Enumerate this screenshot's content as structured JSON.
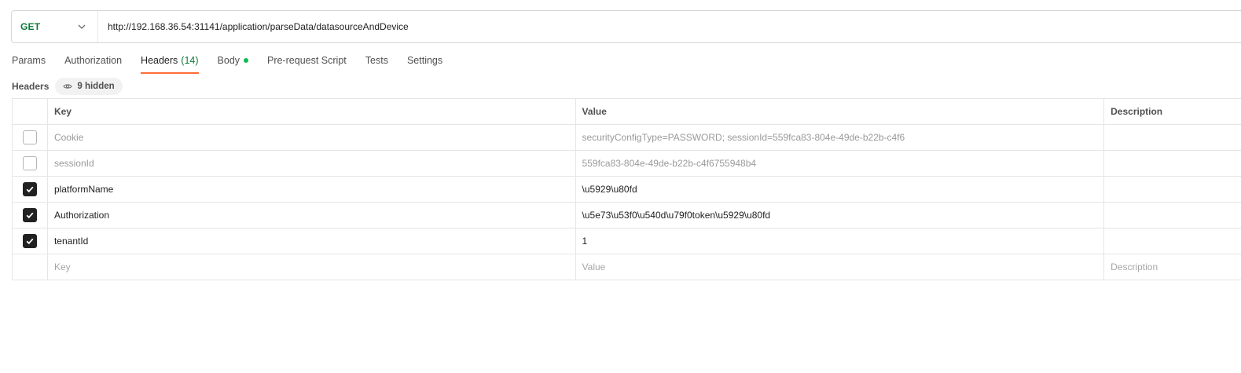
{
  "request": {
    "method": "GET",
    "url": "http://192.168.36.54:31141/application/parseData/datasourceAndDevice"
  },
  "tabs": [
    {
      "label": "Params"
    },
    {
      "label": "Authorization"
    },
    {
      "label": "Headers",
      "count": "(14)",
      "active": true
    },
    {
      "label": "Body",
      "indicator": "green-dot"
    },
    {
      "label": "Pre-request Script"
    },
    {
      "label": "Tests"
    },
    {
      "label": "Settings"
    }
  ],
  "headers_section": {
    "title": "Headers",
    "hidden_label": "9 hidden",
    "hidden_icon": "eye-icon"
  },
  "table": {
    "columns": {
      "key": "Key",
      "value": "Value",
      "description": "Description"
    },
    "rows": [
      {
        "checked": false,
        "key": "Cookie",
        "value": "securityConfigType=PASSWORD; sessionId=559fca83-804e-49de-b22b-c4f6",
        "description": ""
      },
      {
        "checked": false,
        "key": "sessionId",
        "value": "559fca83-804e-49de-b22b-c4f6755948b4",
        "description": ""
      },
      {
        "checked": true,
        "key": "platformName",
        "value": "\\u5929\\u80fd",
        "description": ""
      },
      {
        "checked": true,
        "key": "Authorization",
        "value": "\\u5e73\\u53f0\\u540d\\u79f0token\\u5929\\u80fd",
        "description": ""
      },
      {
        "checked": true,
        "key": "tenantId",
        "value": "1",
        "description": ""
      }
    ],
    "new_row": {
      "key_placeholder": "Key",
      "value_placeholder": "Value",
      "description_placeholder": "Description"
    }
  },
  "colors": {
    "method": "#0b7a3a",
    "active_tab_underline": "#ff6c37",
    "body_dot": "#0cbb52",
    "checkbox_checked": "#212121"
  }
}
